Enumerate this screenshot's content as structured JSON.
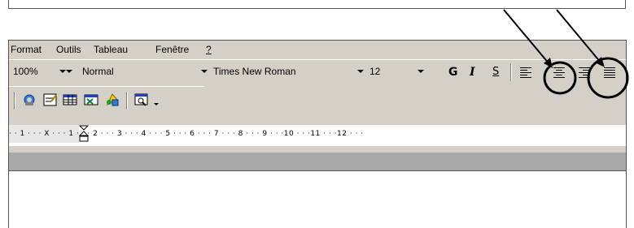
{
  "menu": {
    "items": [
      {
        "label": "Format",
        "u": ""
      },
      {
        "label": "Outils",
        "u": ""
      },
      {
        "label": "Tableau",
        "u": ""
      },
      {
        "label": "Fenêtre",
        "u": ""
      },
      {
        "label": "?",
        "u": ""
      }
    ]
  },
  "formatting": {
    "zoom": "100%",
    "style": "Normal",
    "font": "Times New Roman",
    "size": "12",
    "bold": "G",
    "italic": "I",
    "underline": "S"
  },
  "ruler": {
    "labels": "· · 1 · · · X · · · 1 · · · 2 · · · 3 · · · 4 · · · 5 · · · 6 · · · 7 · · · 8 · · · 9 · · ·10 · · ·11 · · ·12 · · ·"
  },
  "colors": {
    "toolbar_bg": "#d4d0c8",
    "ruler_bar": "#a9a9a9"
  },
  "icons": [
    "internet-explorer-icon",
    "form-icon",
    "table-icon",
    "excel-icon",
    "drawing-icon",
    "document-map-icon"
  ]
}
